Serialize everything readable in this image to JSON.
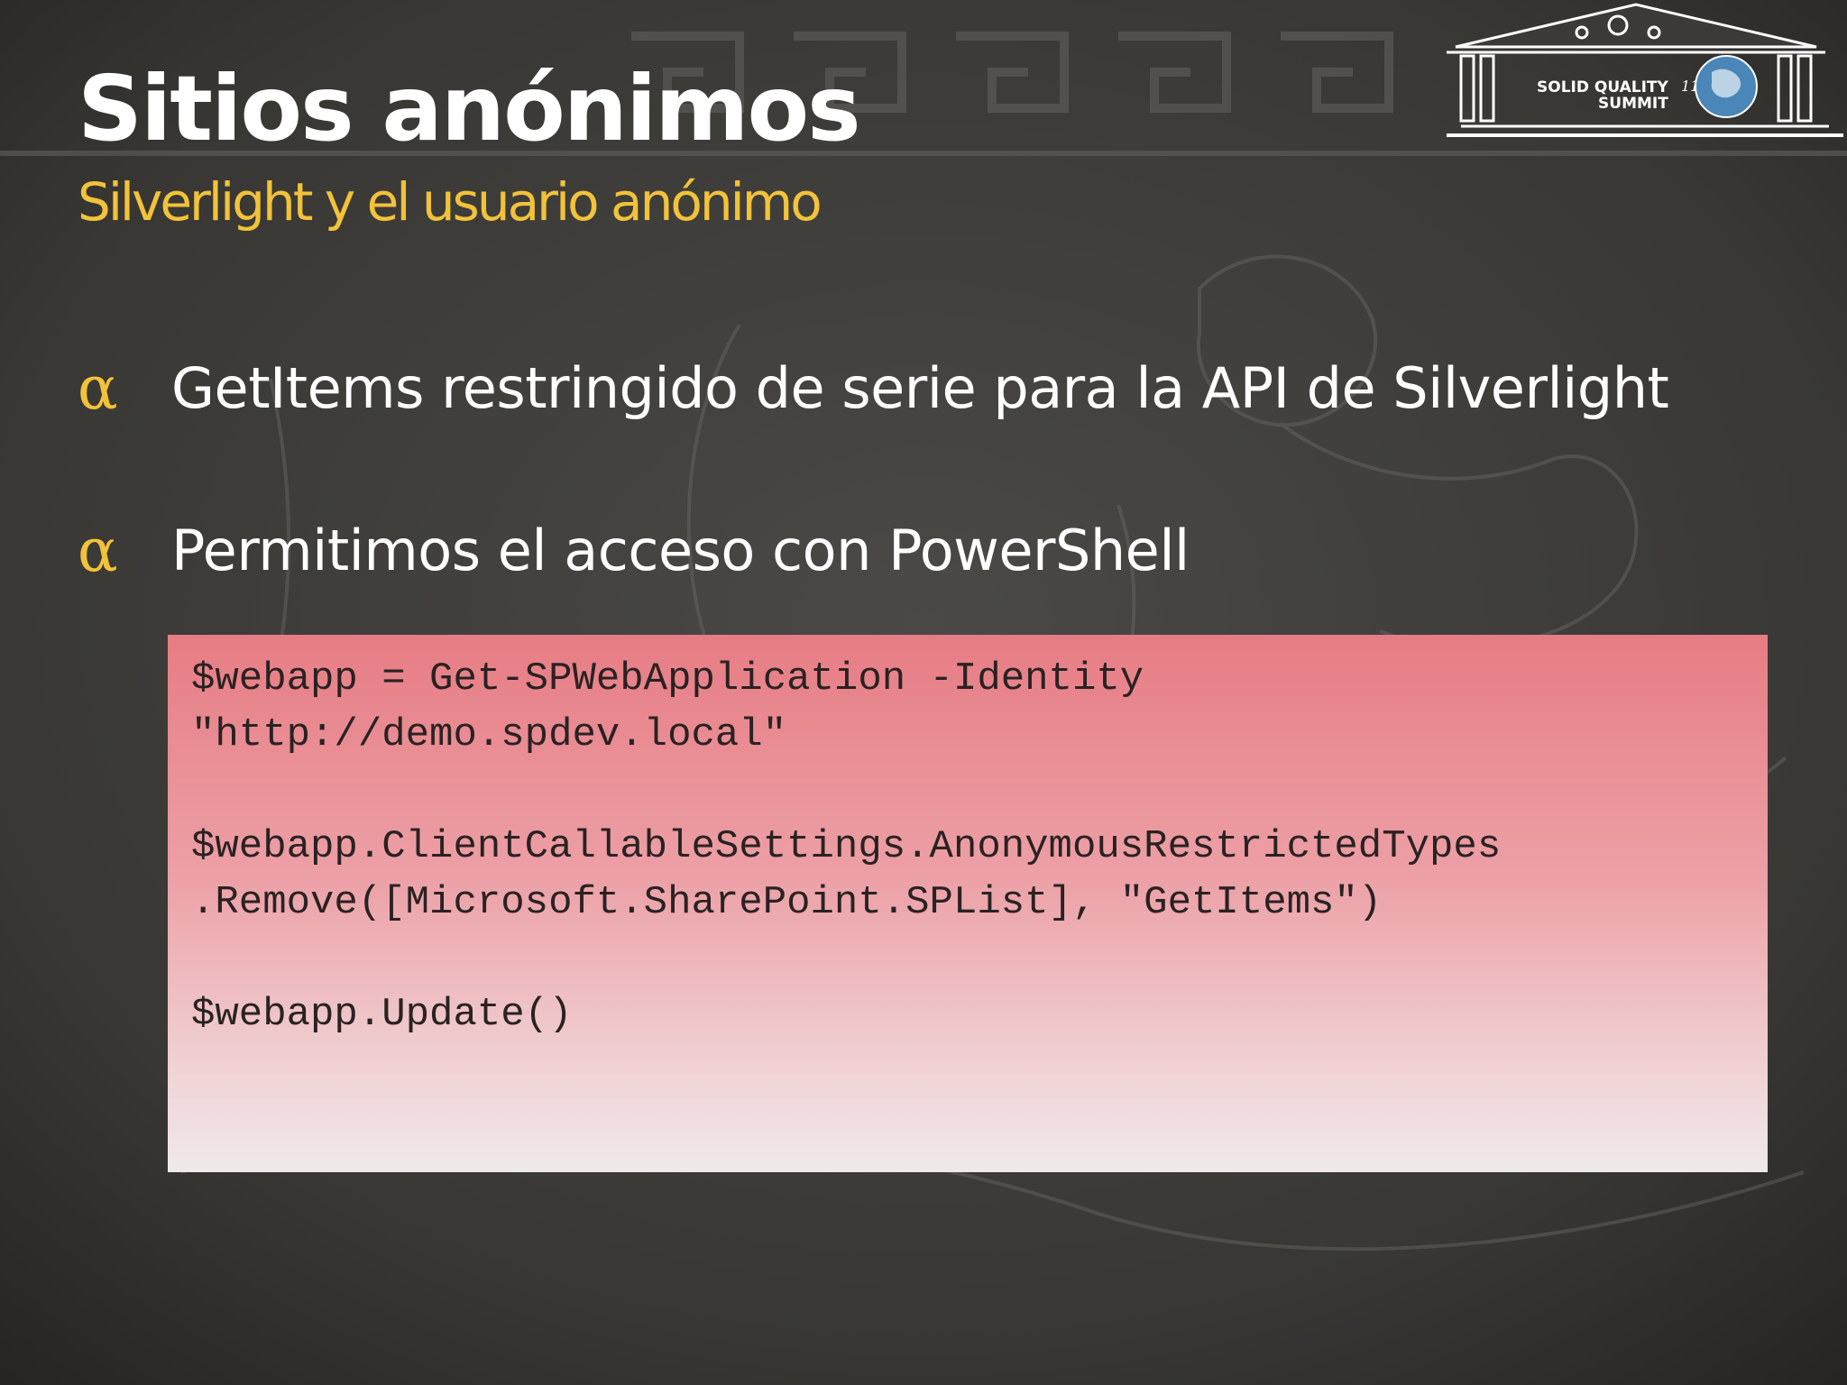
{
  "slide": {
    "title": "Sitios anónimos",
    "subtitle": "Silverlight y el usuario anónimo",
    "bullet_glyph": "α",
    "bullets": [
      {
        "text": "GetItems restringido de serie para la API de Silverlight"
      },
      {
        "text": "Permitimos el acceso con PowerShell"
      }
    ],
    "code": {
      "lines": [
        "$webapp = Get-SPWebApplication -Identity",
        "\"http://demo.spdev.local\"",
        "",
        "$webapp.ClientCallableSettings.AnonymousRestrictedTypes",
        ".Remove([Microsoft.SharePoint.SPList], \"GetItems\")",
        "",
        "$webapp.Update()"
      ]
    }
  },
  "logo": {
    "line1": "SOLID QUALITY",
    "line2": "SUMMIT",
    "edition": "11"
  },
  "colors": {
    "accent": "#f2c23a",
    "title": "#ffffff",
    "code_bg_top": "#e77c84",
    "code_bg_bottom": "#efe9ea"
  }
}
